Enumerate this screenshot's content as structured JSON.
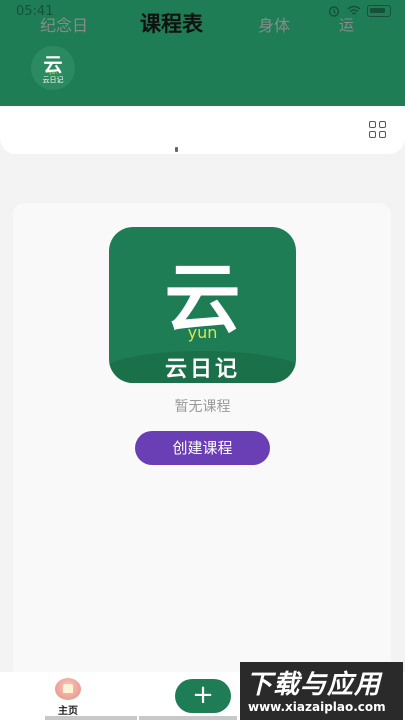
{
  "status": {
    "time": "05:41"
  },
  "avatar": {
    "glyph": "云",
    "sub": "云日记",
    "yun": "yun"
  },
  "tabs": [
    {
      "label": "纪念日",
      "active": false
    },
    {
      "label": "课程表",
      "active": true
    },
    {
      "label": "身体",
      "active": false
    },
    {
      "label": "运",
      "active": false
    }
  ],
  "main": {
    "logo": {
      "glyph": "云",
      "yun": "yun",
      "name": "云日记"
    },
    "empty_text": "暂无课程",
    "create_label": "创建课程"
  },
  "bottom_nav": {
    "home_label": "主页",
    "add_label": "+"
  },
  "watermark": {
    "title": "下载与应用",
    "url": "www.xiazaiplao.com"
  },
  "colors": {
    "brand_green": "#1e7d55",
    "accent_purple": "#6a3fb5",
    "logo_yellow": "#d4e94f"
  }
}
